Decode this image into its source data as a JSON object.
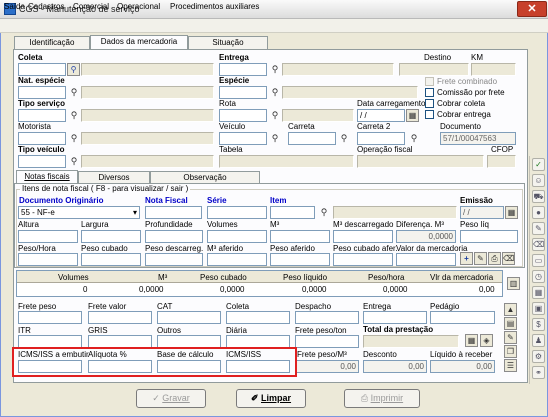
{
  "window": {
    "title": "CGS - Manutenção de serviço",
    "close_glyph": "✕"
  },
  "menu": [
    "Saída",
    "Cadastros",
    "Comercial",
    "Operacional",
    "Procedimentos auxiliares"
  ],
  "top_tabs": [
    "Identificação",
    "Dados da mercadoria",
    "Situação"
  ],
  "header": {
    "coleta": "Coleta",
    "entrega": "Entrega",
    "destino": "Destino",
    "km": "KM",
    "nat_especie": "Nat. espécie",
    "especie": "Espécie",
    "tipo_servico": "Tipo serviço",
    "rota": "Rota",
    "data_carregamento": "Data carregamento",
    "data_value": " / /",
    "calendar_glyph": "▦",
    "motorista": "Motorista",
    "veiculo": "Veículo",
    "carreta": "Carreta",
    "carreta2": "Carreta 2",
    "documento": "Documento",
    "documento_value": "57/1/00047563",
    "tipo_veiculo": "Tipo veículo",
    "tabela": "Tabela",
    "operacao_fiscal": "Operação fiscal",
    "cfop": "CFOP",
    "checkboxes": [
      "Frete combinado",
      "Comissão por frete",
      "Cobrar coleta",
      "Cobrar entrega"
    ]
  },
  "inner_tabs": [
    "Notas fiscais",
    "Diversos",
    "Observação"
  ],
  "nf": {
    "group_title": "Itens de nota fiscal ( F8 - para visualizar / sair )",
    "doc_originario": "Documento Originário",
    "doc_value": "55 - NF-e",
    "nota_fiscal": "Nota Fiscal",
    "serie": "Série",
    "item": "Item",
    "emissao": "Emissão",
    "emissao_value": " / /",
    "altura": "Altura",
    "largura": "Largura",
    "profundidade": "Profundidade",
    "volumes": "Volumes",
    "m3": "M³",
    "m3_descarregado": "M³ descarregado",
    "diferenca_m3": "Diferença. M³",
    "peso_liq": "Peso líq",
    "diferenca_value": "0,0000",
    "peso_hora": "Peso/Hora",
    "peso_cubado": "Peso cubado",
    "peso_descarreg": "Peso descarreg.",
    "m3_aferido": "M³ aferido",
    "peso_aferido": "Peso aferido",
    "peso_cubado_afer": "Peso cubado afer.",
    "valor_mercadoria": "Valor da mercadoria",
    "plus_glyph": "+"
  },
  "totals": {
    "headers": [
      "Volumes",
      "M³",
      "Peso cubado",
      "Peso líquido",
      "Peso/hora",
      "Vlr da mercadoria"
    ],
    "values": [
      "0",
      "0,0000",
      "0,0000",
      "0,0000",
      "0,0000",
      "0,00"
    ]
  },
  "freight": {
    "row1": [
      "Frete peso",
      "Frete valor",
      "CAT",
      "Coleta",
      "Despacho",
      "Entrega",
      "Pedágio"
    ],
    "row2": [
      "ITR",
      "GRIS",
      "Outros",
      "Diária",
      "Frete peso/ton",
      "Total da prestação"
    ],
    "row3": [
      "ICMS/ISS a embutir",
      "Alíquota %",
      "Base de cálculo",
      "ICMS/ISS",
      "Frete peso/M³",
      "Desconto",
      "Líquido à receber"
    ],
    "row3_values": [
      "0,00",
      "0,00",
      "0,00"
    ]
  },
  "buttons": {
    "gravar": "Gravar",
    "limpar": "Limpar",
    "imprimir": "Imprimir"
  },
  "colors": {
    "highlight": "#e02020",
    "label_blue": "#0000c8",
    "face": "#ece9d8"
  }
}
